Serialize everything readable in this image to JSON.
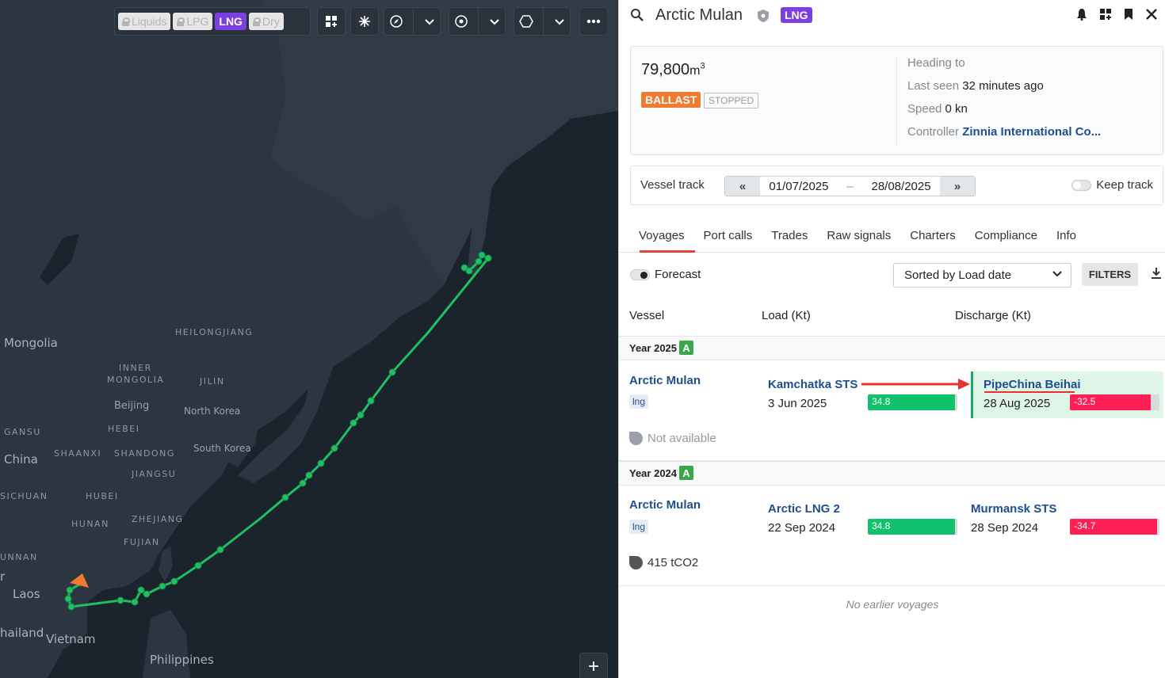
{
  "map": {
    "filter_chips": [
      {
        "label": "Liquids",
        "locked": true,
        "active": false
      },
      {
        "label": "LPG",
        "locked": true,
        "active": false
      },
      {
        "label": "LNG",
        "locked": false,
        "active": true
      },
      {
        "label": "Dry",
        "locked": true,
        "active": false
      }
    ],
    "toolbar_icons": [
      "layers-icon",
      "wind-icon",
      "compass-icon",
      "chevron-down-icon",
      "target-icon",
      "chevron-down-icon",
      "hexagon-icon",
      "chevron-down-icon",
      "more-icon"
    ],
    "labels": {
      "mongolia": "Mongolia",
      "heilongjiang": "HEILONGJIANG",
      "inner_mongolia_1": "INNER",
      "inner_mongolia_2": "MONGOLIA",
      "jilin": "JILIN",
      "beijing": "Beijing",
      "north_korea": "North Korea",
      "hebei": "HEBEI",
      "gansu": "GANSU",
      "china": "China",
      "shaanxi": "SHAANXI",
      "shandong": "SHANDONG",
      "south_korea": "South Korea",
      "jiangsu": "JIANGSU",
      "sichuan": "SICHUAN",
      "hubei": "HUBEI",
      "hunan": "HUNAN",
      "zhejiang": "ZHEJIANG",
      "fujian": "FUJIAN",
      "yunnan": "UNNAN",
      "laos": "Laos",
      "thailand": "hailand",
      "vietnam": "Vietnam",
      "philippines": "Philippines",
      "r_fragment": "r"
    },
    "zoom_label": "+"
  },
  "header": {
    "vessel_name": "Arctic Mulan",
    "type_badge": "LNG",
    "icons": [
      "bell-icon",
      "grid-add-icon",
      "bookmark-icon",
      "close-icon"
    ]
  },
  "summary": {
    "capacity": "79,800",
    "capacity_unit": "m",
    "capacity_sup": "3",
    "status_badge": "BALLAST",
    "state_badge": "STOPPED",
    "heading_label": "Heading to",
    "last_seen_label": "Last seen",
    "last_seen_value": "32 minutes ago",
    "speed_label": "Speed",
    "speed_value": "0 kn",
    "controller_label": "Controller",
    "controller_value": "Zinnia International Co..."
  },
  "track": {
    "label": "Vessel track",
    "prev": "«",
    "next": "»",
    "from": "01/07/2025",
    "dash": "–",
    "to": "28/08/2025",
    "keep_label": "Keep track"
  },
  "tabs": [
    "Voyages",
    "Port calls",
    "Trades",
    "Raw signals",
    "Charters",
    "Compliance",
    "Info"
  ],
  "controls": {
    "forecast_label": "Forecast",
    "sort_label": "Sorted by Load date",
    "filters_label": "FILTERS"
  },
  "columns": {
    "vessel": "Vessel",
    "load": "Load (Kt)",
    "discharge": "Discharge (Kt)"
  },
  "years": [
    {
      "year": "Year 2025",
      "badge": "A",
      "voyage": {
        "vessel": "Arctic Mulan",
        "tag": "lng",
        "load_port": "Kamchatka STS",
        "load_date": "3 Jun 2025",
        "load_value": "34.8",
        "load_fill": 0.97,
        "discharge_port": "PipeChina Beihai",
        "discharge_date": "28 Aug 2025",
        "discharge_value": "-32.5",
        "discharge_fill": 0.9,
        "emissions": "Not available"
      }
    },
    {
      "year": "Year 2024",
      "badge": "A",
      "voyage": {
        "vessel": "Arctic Mulan",
        "tag": "lng",
        "load_port": "Arctic LNG 2",
        "load_date": "22 Sep 2024",
        "load_value": "34.8",
        "load_fill": 0.97,
        "discharge_port": "Murmansk STS",
        "discharge_date": "28 Sep 2024",
        "discharge_value": "-34.7",
        "discharge_fill": 0.97,
        "emissions": "415 tCO2"
      }
    }
  ],
  "footer_note": "No earlier voyages",
  "colors": {
    "accent_purple": "#7b3fe4",
    "ballast": "#f07a2f",
    "load_green": "#11c26d",
    "discharge_red": "#ff1f55",
    "track_green": "#1fbf62"
  }
}
